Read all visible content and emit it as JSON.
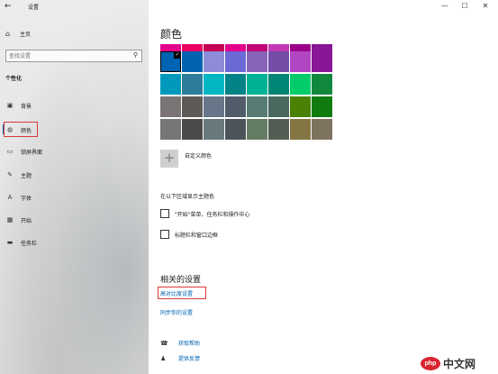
{
  "window": {
    "title": "设置",
    "back_icon": "←",
    "min_icon": "—",
    "max_icon": "☐",
    "close_icon": "✕"
  },
  "sidebar": {
    "home_icon": "⌂",
    "home_label": "主页",
    "search_placeholder": "查找设置",
    "search_icon": "⚲",
    "section_title": "个性化",
    "items": [
      {
        "icon": "▣",
        "label": "背景"
      },
      {
        "icon": "◍",
        "label": "颜色"
      },
      {
        "icon": "▭",
        "label": "锁屏界面"
      },
      {
        "icon": "✎",
        "label": "主题"
      },
      {
        "icon": "A",
        "label": "字体"
      },
      {
        "icon": "▦",
        "label": "开始"
      },
      {
        "icon": "▬",
        "label": "任务栏"
      }
    ],
    "selected_index": 1
  },
  "main": {
    "title": "颜色",
    "swatch_rows": [
      [
        "#e3008c",
        "#ea005e",
        "#c30052",
        "#e3008c",
        "#bf0077",
        "#c239b3",
        "#9a0089",
        "#881798"
      ],
      [
        "#0063b1",
        "#0063b1",
        "#8e8cd8",
        "#6b69d6",
        "#8764b8",
        "#744da9",
        "#b146c2",
        "#881798"
      ],
      [
        "#0099bc",
        "#2d7d9a",
        "#00b7c3",
        "#038387",
        "#00b294",
        "#018574",
        "#00cc6a",
        "#10893e"
      ],
      [
        "#7a7574",
        "#5d5a58",
        "#68768a",
        "#515c6b",
        "#567c73",
        "#486860",
        "#498205",
        "#107c10"
      ],
      [
        "#767676",
        "#4c4a48",
        "#69797e",
        "#4a5459",
        "#647c64",
        "#525e54",
        "#847545",
        "#7e735f"
      ]
    ],
    "selected_swatch": "#0063b1",
    "check_icon": "✓",
    "custom_color_icon": "+",
    "custom_color_label": "自定义颜色",
    "show_accent_label": "在以下区域显示主题色",
    "checkbox_start": "\"开始\"菜单、任务栏和操作中心",
    "checkbox_titlebar": "标题栏和窗口边框",
    "related_title": "相关的设置",
    "link_contrast": "高对比度设置",
    "link_sync": "同步你的设置",
    "help_icon": "☎",
    "help_label": "获取帮助",
    "feedback_icon": "♟",
    "feedback_label": "提供反馈"
  },
  "watermark": {
    "logo": "php",
    "text": "中文网"
  },
  "colors": {
    "accent": "#0063b1",
    "highlight_box": "#d63a3a"
  }
}
